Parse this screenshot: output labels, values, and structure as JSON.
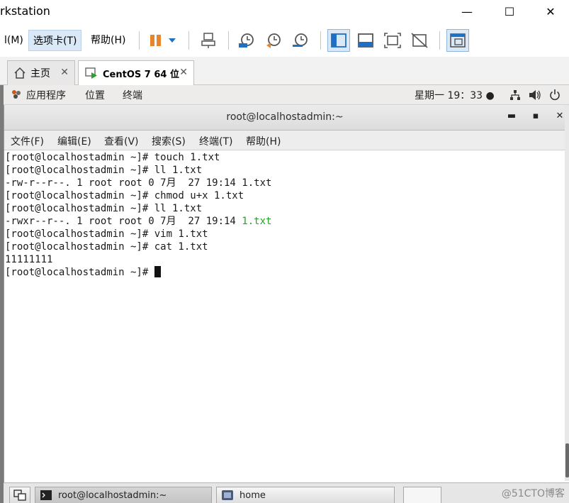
{
  "vmware": {
    "title": "rkstation",
    "window_controls": {
      "minimize": "—",
      "maximize": "☐",
      "close": "✕"
    },
    "menus": [
      {
        "label": "l(M)"
      },
      {
        "label": "选项卡(T)"
      },
      {
        "label": "帮助(H)"
      }
    ],
    "tabs": [
      {
        "label": "主页",
        "close": "✕"
      },
      {
        "label": "CentOS 7 64 位",
        "close": "✕"
      }
    ]
  },
  "gnome": {
    "apps": "应用程序",
    "places": "位置",
    "terminal": "终端",
    "clock": "星期一 19：33 ●"
  },
  "terminal": {
    "title": "root@localhostadmin:~",
    "controls": {
      "minimize": "▬",
      "maximize": "▪",
      "close": "✕"
    },
    "menus": [
      "文件(F)",
      "编辑(E)",
      "查看(V)",
      "搜索(S)",
      "终端(T)",
      "帮助(H)"
    ],
    "lines": [
      {
        "text": "[root@localhostadmin ~]# touch 1.txt"
      },
      {
        "text": "[root@localhostadmin ~]# ll 1.txt"
      },
      {
        "text": "-rw-r--r--. 1 root root 0 7月  27 19:14 1.txt"
      },
      {
        "text": "[root@localhostadmin ~]# chmod u+x 1.txt"
      },
      {
        "text": "[root@localhostadmin ~]# ll 1.txt"
      },
      {
        "prefix": "-rwxr--r--. 1 root root 0 7月  27 19:14 ",
        "highlight": "1.txt"
      },
      {
        "text": "[root@localhostadmin ~]# vim 1.txt"
      },
      {
        "text": "[root@localhostadmin ~]# cat 1.txt"
      },
      {
        "text": "11111111"
      },
      {
        "text": "[root@localhostadmin ~]# "
      }
    ]
  },
  "taskbar": {
    "items": [
      {
        "label": "root@localhostadmin:~"
      },
      {
        "label": "home"
      }
    ],
    "watermark": "@51CTO博客"
  },
  "colors": {
    "highlight_file": "#27a12a",
    "vm_accent": "#1f6fc5",
    "pause_orange": "#e8852b"
  }
}
